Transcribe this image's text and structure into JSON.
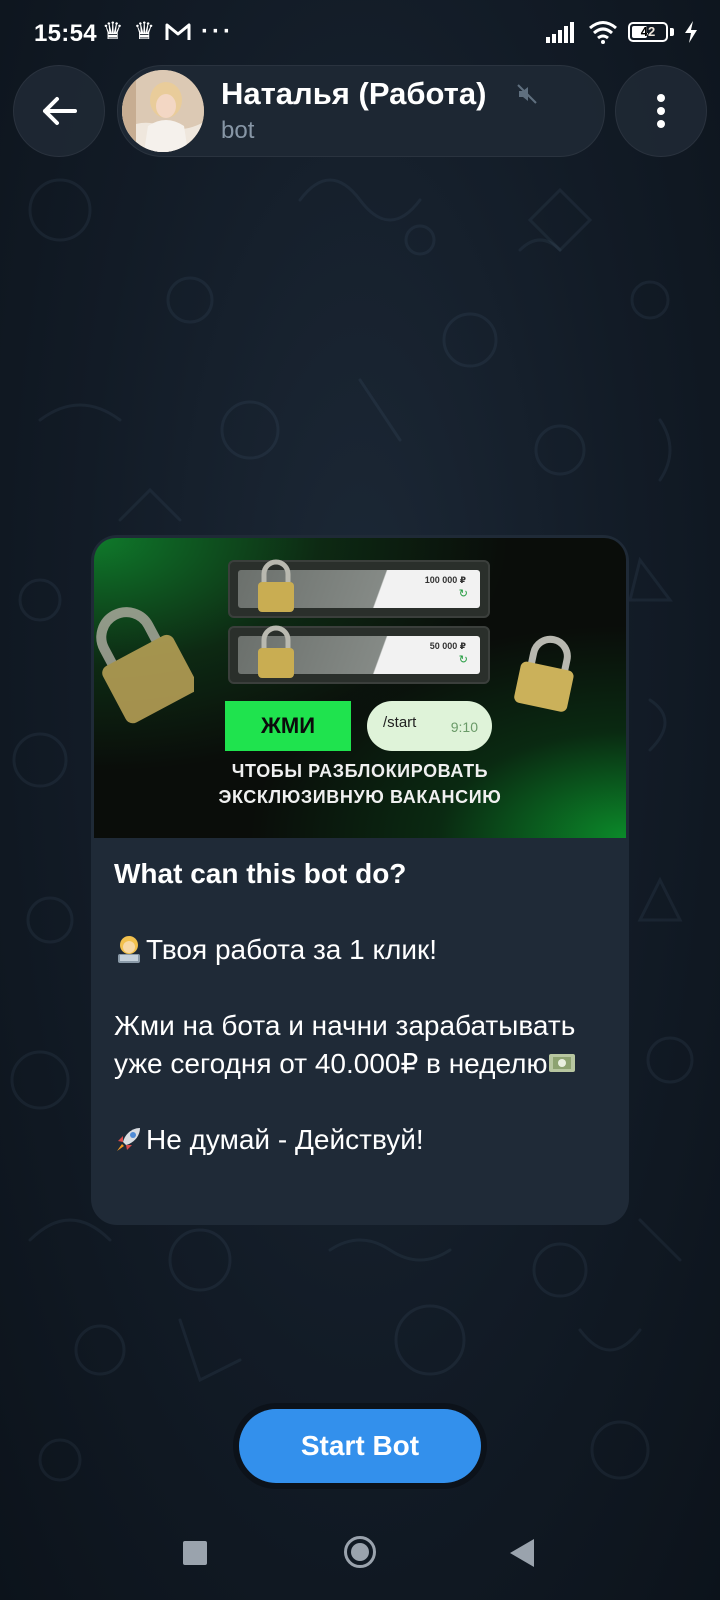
{
  "status_bar": {
    "time": "15:54",
    "left_icons": [
      "crown-icon",
      "crown-icon",
      "gmail-icon"
    ],
    "more": "···",
    "battery_level": "42",
    "right_icons": [
      "signal-icon",
      "wifi-icon",
      "battery-icon",
      "charging-icon"
    ]
  },
  "header": {
    "title": "Наталья (Работа)",
    "subtitle": "bot",
    "back_icon": "arrow-left-icon",
    "menu_icon": "kebab-menu-icon",
    "muted_icon": "muted-speaker-icon"
  },
  "promo": {
    "amount_1": "100 000 ₽",
    "amount_2": "50 000 ₽",
    "press_label": "ЖМИ",
    "command": "/start",
    "command_time": "9:10",
    "caption_line_1": "ЧТОБЫ РАЗБЛОКИРОВАТЬ",
    "caption_line_2": "ЭКСКЛЮЗИВНУЮ ВАКАНСИЮ"
  },
  "description": {
    "heading": "What can this bot do?",
    "line_1": "Твоя работа за 1 клик!",
    "line_2": "Жми на бота и начни зарабатывать уже сегодня от 40.000₽ в неделю",
    "line_3": "Не думай - Действуй!"
  },
  "start_button": {
    "label": "Start Bot"
  },
  "colors": {
    "accent": "#3390ec",
    "card": "#1f2a37",
    "background": "#121b26",
    "promo_green": "#1fe34e"
  },
  "navigation": {
    "icons": [
      "recent-apps-icon",
      "home-icon",
      "back-triangle-icon"
    ]
  }
}
